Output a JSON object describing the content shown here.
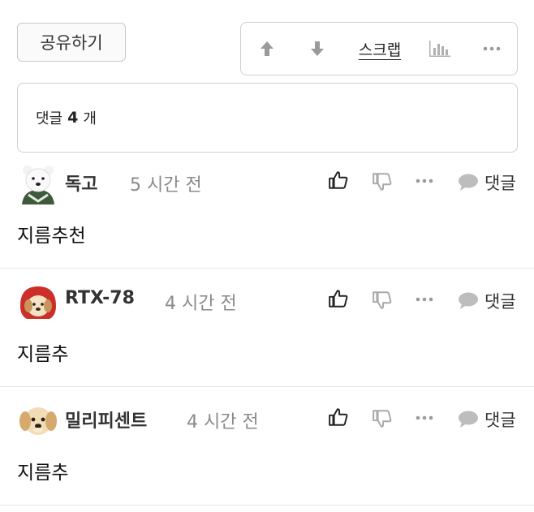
{
  "actions": {
    "share_label": "공유하기",
    "scrap_label": "스크랩"
  },
  "comment_count": {
    "prefix": "댓글",
    "count": "4",
    "suffix": "개"
  },
  "comments": [
    {
      "author": "독고",
      "time": "5 시간 전",
      "text": "지름추천",
      "reply_label": "댓글"
    },
    {
      "author": "RTX-78",
      "time": "4 시간 전",
      "text": "지름추",
      "reply_label": "댓글"
    },
    {
      "author": "밀리피센트",
      "time": "4 시간 전",
      "text": "지름추",
      "reply_label": "댓글"
    }
  ],
  "colors": {
    "border": "#cfcfcf",
    "icon_gray": "#9a9a9a",
    "text_dark": "#222222",
    "time_gray": "#8a8a8a"
  }
}
